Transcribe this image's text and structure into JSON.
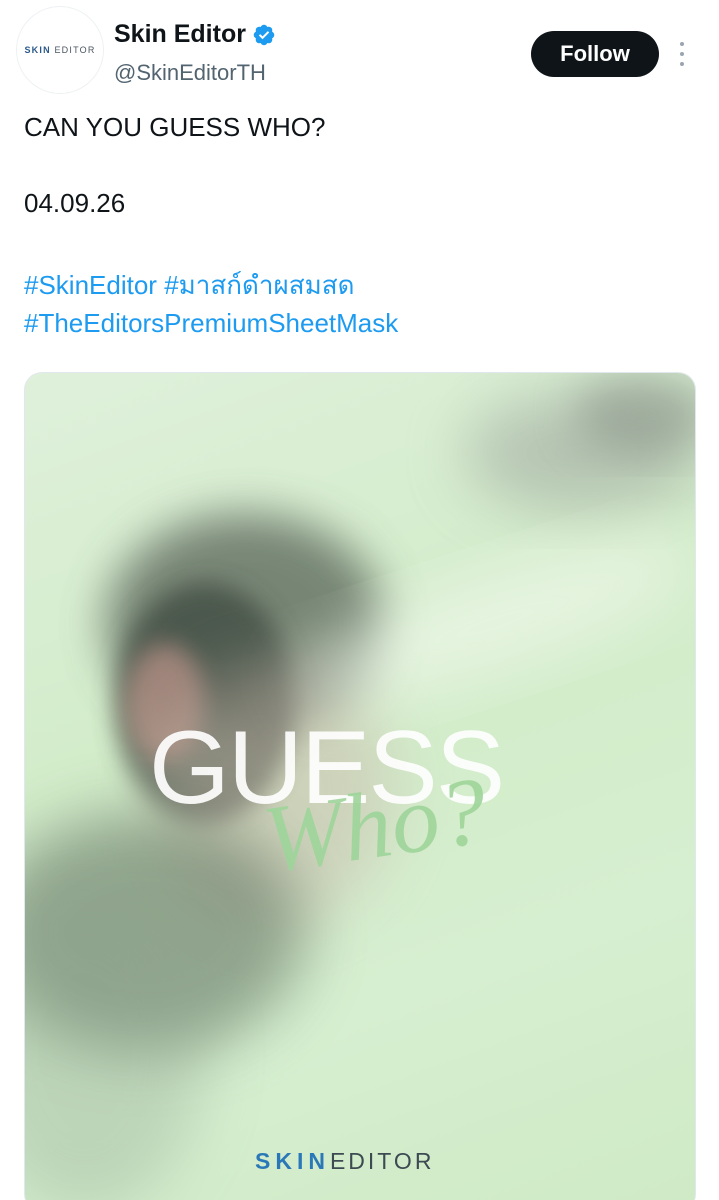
{
  "account": {
    "display_name": "Skin Editor",
    "handle": "@SkinEditorTH",
    "avatar_logo_skin": "SKIN",
    "avatar_logo_editor": "EDITOR"
  },
  "actions": {
    "follow_label": "Follow"
  },
  "tweet": {
    "line1": "CAN YOU GUESS WHO?",
    "line2": "04.09.26",
    "hashtags": [
      "#SkinEditor",
      "#มาสก์ดำผสมสด",
      "#TheEditorsPremiumSheetMask"
    ]
  },
  "media": {
    "headline": "GUESS",
    "subline": "Who?",
    "brand_skin": "SKIN",
    "brand_editor": "EDITOR"
  },
  "colors": {
    "link": "#1d9bf0",
    "verified": "#1d9bf0",
    "media_bg": "#d2ecc9",
    "who_text": "#9ed59a"
  },
  "icons": [
    "verified-badge-icon",
    "more-options-icon"
  ]
}
